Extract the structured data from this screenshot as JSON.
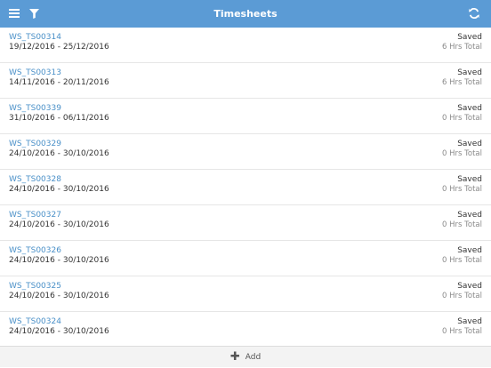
{
  "header": {
    "title": "Timesheets",
    "menu_icon": "hamburger-menu-icon",
    "filter_icon": "filter-funnel-icon",
    "refresh_icon": "refresh-icon",
    "bg_color": "#5b9bd5"
  },
  "timesheets": [
    {
      "id": "WS_TS00314",
      "dates": "19/12/2016 - 25/12/2016",
      "status": "Saved",
      "hours": "6 Hrs Total"
    },
    {
      "id": "WS_TS00313",
      "dates": "14/11/2016 - 20/11/2016",
      "status": "Saved",
      "hours": "6 Hrs Total"
    },
    {
      "id": "WS_TS00339",
      "dates": "31/10/2016 - 06/11/2016",
      "status": "Saved",
      "hours": "0 Hrs Total"
    },
    {
      "id": "WS_TS00329",
      "dates": "24/10/2016 - 30/10/2016",
      "status": "Saved",
      "hours": "0 Hrs Total"
    },
    {
      "id": "WS_TS00328",
      "dates": "24/10/2016 - 30/10/2016",
      "status": "Saved",
      "hours": "0 Hrs Total"
    },
    {
      "id": "WS_TS00327",
      "dates": "24/10/2016 - 30/10/2016",
      "status": "Saved",
      "hours": "0 Hrs Total"
    },
    {
      "id": "WS_TS00326",
      "dates": "24/10/2016 - 30/10/2016",
      "status": "Saved",
      "hours": "0 Hrs Total"
    },
    {
      "id": "WS_TS00325",
      "dates": "24/10/2016 - 30/10/2016",
      "status": "Saved",
      "hours": "0 Hrs Total"
    },
    {
      "id": "WS_TS00324",
      "dates": "24/10/2016 - 30/10/2016",
      "status": "Saved",
      "hours": "0 Hrs Total"
    }
  ],
  "footer": {
    "add_label": "Add",
    "add_icon": "plus-icon"
  }
}
